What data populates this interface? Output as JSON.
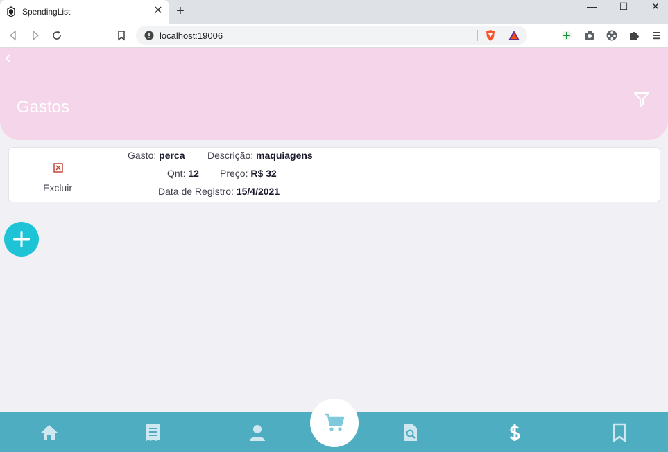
{
  "browser": {
    "tab_title": "SpendingList",
    "tab_close": "✕",
    "new_tab": "+",
    "url": "localhost:19006",
    "window_controls": {
      "minimize": "—",
      "maximize": "☐",
      "close": "✕"
    }
  },
  "header": {
    "search_placeholder": "Gastos",
    "back_icon": "chevron-left-icon",
    "filter_icon": "filter-icon"
  },
  "expenses": [
    {
      "delete_label": "Excluir",
      "gasto_label": "Gasto:",
      "gasto_value": "perca",
      "descricao_label": "Descrição:",
      "descricao_value": "maquiagens",
      "qnt_label": "Qnt:",
      "qnt_value": "12",
      "preco_label": "Preço:",
      "preco_value": "R$ 32",
      "registro_label": "Data de Registro:",
      "registro_value": "15/4/2021"
    }
  ],
  "colors": {
    "header_bg": "#f5d5ea",
    "fab": "#1ec3d6",
    "bottom_nav": "#4fadc2",
    "delete_icon": "#c0392b"
  },
  "bottom_nav": {
    "items": [
      "home-icon",
      "receipt-icon",
      "user-icon",
      "cart-icon",
      "search-document-icon",
      "dollar-icon",
      "bookmark-icon"
    ],
    "active": "cart-icon"
  }
}
